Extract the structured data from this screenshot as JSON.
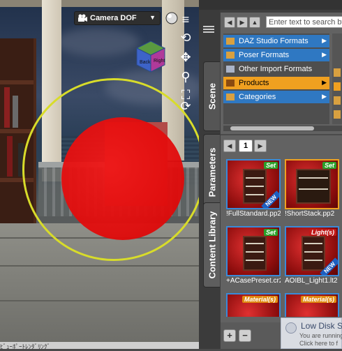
{
  "viewport": {
    "camera": {
      "label": "Camera DOF"
    },
    "view_cube": {
      "front_label": "Back",
      "right_label": "Right"
    },
    "status_text": "ﾋﾞｭｰﾎﾟｰﾄﾚﾝﾀﾞﾘﾝｸﾞ"
  },
  "dock": {
    "tabs": [
      {
        "label": "Scene"
      },
      {
        "label": "Parameters"
      },
      {
        "label": "Content Library"
      }
    ],
    "search": {
      "placeholder": "Enter text to search by..."
    },
    "tree": [
      {
        "label": "DAZ Studio Formats",
        "style": "blue"
      },
      {
        "label": "Poser Formats",
        "style": "blue"
      },
      {
        "label": "Other Import Formats",
        "style": "plain"
      },
      {
        "label": "Products",
        "style": "orange"
      },
      {
        "label": "Categories",
        "style": "blue"
      }
    ],
    "pager": {
      "page": "1"
    },
    "items": [
      {
        "caption": "!FullStandard.pp2",
        "badge": "Set",
        "badge_color": "green",
        "new": "NEW"
      },
      {
        "caption": "!ShortStack.pp2",
        "badge": "Set",
        "badge_color": "green",
        "new": ""
      },
      {
        "caption": "+ACasePreset.cr2",
        "badge": "Set",
        "badge_color": "green",
        "new": ""
      },
      {
        "caption": "AOIBL_Light1.lt2",
        "badge": "Light(s)",
        "badge_color": "red",
        "new": "NEW"
      },
      {
        "caption": "",
        "badge": "Material(s)",
        "badge_color": "orange",
        "new": ""
      },
      {
        "caption": "",
        "badge": "Material(s)",
        "badge_color": "orange",
        "new": ""
      }
    ],
    "bottom": {
      "add": "+",
      "remove": "−"
    }
  },
  "toast": {
    "title": "Low Disk S",
    "line1": "You are running",
    "line2": "Click here to f"
  },
  "colors": {
    "accent_blue": "#2f78c2",
    "accent_orange": "#f0a020",
    "gizmo_yellow": "#d8dc2a",
    "gizmo_red": "#e00a0a"
  }
}
